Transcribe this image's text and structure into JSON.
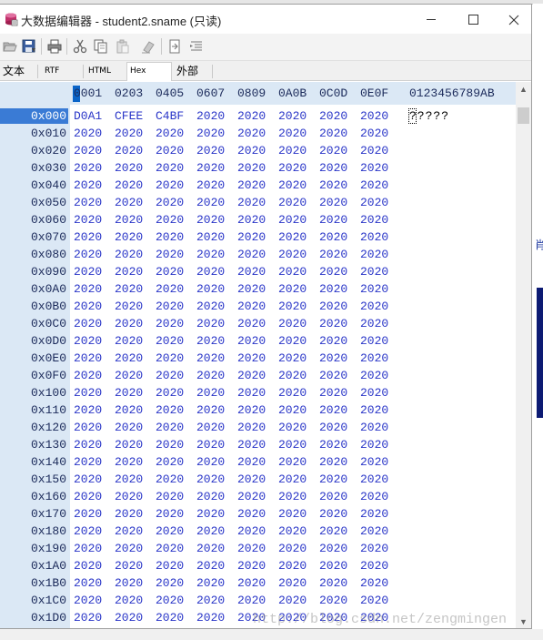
{
  "window": {
    "title": "大数据编辑器 - student2.sname (只读)"
  },
  "toolbar": {
    "buttons": [
      "open-icon",
      "save-icon",
      "print-icon",
      "cut-icon",
      "copy-icon",
      "paste-icon",
      "clear-icon",
      "import-icon",
      "export-icon"
    ]
  },
  "tabs": [
    {
      "label": "文本",
      "active": false
    },
    {
      "label": "RTF",
      "active": false
    },
    {
      "label": "HTML",
      "active": false
    },
    {
      "label": "Hex",
      "active": true
    },
    {
      "label": "外部",
      "active": false
    }
  ],
  "hex": {
    "header_columns": [
      "0001",
      "0203",
      "0405",
      "0607",
      "0809",
      "0A0B",
      "0C0D",
      "0E0F"
    ],
    "header_ascii": "0123456789AB",
    "rows": [
      {
        "addr": "0x000",
        "cells": [
          "D0A1",
          "CFEE",
          "C4BF",
          "2020",
          "2020",
          "2020",
          "2020",
          "2020"
        ],
        "ascii": "?????"
      },
      {
        "addr": "0x010",
        "cells": [
          "2020",
          "2020",
          "2020",
          "2020",
          "2020",
          "2020",
          "2020",
          "2020"
        ],
        "ascii": ""
      },
      {
        "addr": "0x020",
        "cells": [
          "2020",
          "2020",
          "2020",
          "2020",
          "2020",
          "2020",
          "2020",
          "2020"
        ],
        "ascii": ""
      },
      {
        "addr": "0x030",
        "cells": [
          "2020",
          "2020",
          "2020",
          "2020",
          "2020",
          "2020",
          "2020",
          "2020"
        ],
        "ascii": ""
      },
      {
        "addr": "0x040",
        "cells": [
          "2020",
          "2020",
          "2020",
          "2020",
          "2020",
          "2020",
          "2020",
          "2020"
        ],
        "ascii": ""
      },
      {
        "addr": "0x050",
        "cells": [
          "2020",
          "2020",
          "2020",
          "2020",
          "2020",
          "2020",
          "2020",
          "2020"
        ],
        "ascii": ""
      },
      {
        "addr": "0x060",
        "cells": [
          "2020",
          "2020",
          "2020",
          "2020",
          "2020",
          "2020",
          "2020",
          "2020"
        ],
        "ascii": ""
      },
      {
        "addr": "0x070",
        "cells": [
          "2020",
          "2020",
          "2020",
          "2020",
          "2020",
          "2020",
          "2020",
          "2020"
        ],
        "ascii": ""
      },
      {
        "addr": "0x080",
        "cells": [
          "2020",
          "2020",
          "2020",
          "2020",
          "2020",
          "2020",
          "2020",
          "2020"
        ],
        "ascii": ""
      },
      {
        "addr": "0x090",
        "cells": [
          "2020",
          "2020",
          "2020",
          "2020",
          "2020",
          "2020",
          "2020",
          "2020"
        ],
        "ascii": ""
      },
      {
        "addr": "0x0A0",
        "cells": [
          "2020",
          "2020",
          "2020",
          "2020",
          "2020",
          "2020",
          "2020",
          "2020"
        ],
        "ascii": ""
      },
      {
        "addr": "0x0B0",
        "cells": [
          "2020",
          "2020",
          "2020",
          "2020",
          "2020",
          "2020",
          "2020",
          "2020"
        ],
        "ascii": ""
      },
      {
        "addr": "0x0C0",
        "cells": [
          "2020",
          "2020",
          "2020",
          "2020",
          "2020",
          "2020",
          "2020",
          "2020"
        ],
        "ascii": ""
      },
      {
        "addr": "0x0D0",
        "cells": [
          "2020",
          "2020",
          "2020",
          "2020",
          "2020",
          "2020",
          "2020",
          "2020"
        ],
        "ascii": ""
      },
      {
        "addr": "0x0E0",
        "cells": [
          "2020",
          "2020",
          "2020",
          "2020",
          "2020",
          "2020",
          "2020",
          "2020"
        ],
        "ascii": ""
      },
      {
        "addr": "0x0F0",
        "cells": [
          "2020",
          "2020",
          "2020",
          "2020",
          "2020",
          "2020",
          "2020",
          "2020"
        ],
        "ascii": ""
      },
      {
        "addr": "0x100",
        "cells": [
          "2020",
          "2020",
          "2020",
          "2020",
          "2020",
          "2020",
          "2020",
          "2020"
        ],
        "ascii": ""
      },
      {
        "addr": "0x110",
        "cells": [
          "2020",
          "2020",
          "2020",
          "2020",
          "2020",
          "2020",
          "2020",
          "2020"
        ],
        "ascii": ""
      },
      {
        "addr": "0x120",
        "cells": [
          "2020",
          "2020",
          "2020",
          "2020",
          "2020",
          "2020",
          "2020",
          "2020"
        ],
        "ascii": ""
      },
      {
        "addr": "0x130",
        "cells": [
          "2020",
          "2020",
          "2020",
          "2020",
          "2020",
          "2020",
          "2020",
          "2020"
        ],
        "ascii": ""
      },
      {
        "addr": "0x140",
        "cells": [
          "2020",
          "2020",
          "2020",
          "2020",
          "2020",
          "2020",
          "2020",
          "2020"
        ],
        "ascii": ""
      },
      {
        "addr": "0x150",
        "cells": [
          "2020",
          "2020",
          "2020",
          "2020",
          "2020",
          "2020",
          "2020",
          "2020"
        ],
        "ascii": ""
      },
      {
        "addr": "0x160",
        "cells": [
          "2020",
          "2020",
          "2020",
          "2020",
          "2020",
          "2020",
          "2020",
          "2020"
        ],
        "ascii": ""
      },
      {
        "addr": "0x170",
        "cells": [
          "2020",
          "2020",
          "2020",
          "2020",
          "2020",
          "2020",
          "2020",
          "2020"
        ],
        "ascii": ""
      },
      {
        "addr": "0x180",
        "cells": [
          "2020",
          "2020",
          "2020",
          "2020",
          "2020",
          "2020",
          "2020",
          "2020"
        ],
        "ascii": ""
      },
      {
        "addr": "0x190",
        "cells": [
          "2020",
          "2020",
          "2020",
          "2020",
          "2020",
          "2020",
          "2020",
          "2020"
        ],
        "ascii": ""
      },
      {
        "addr": "0x1A0",
        "cells": [
          "2020",
          "2020",
          "2020",
          "2020",
          "2020",
          "2020",
          "2020",
          "2020"
        ],
        "ascii": ""
      },
      {
        "addr": "0x1B0",
        "cells": [
          "2020",
          "2020",
          "2020",
          "2020",
          "2020",
          "2020",
          "2020",
          "2020"
        ],
        "ascii": ""
      },
      {
        "addr": "0x1C0",
        "cells": [
          "2020",
          "2020",
          "2020",
          "2020",
          "2020",
          "2020",
          "2020",
          "2020"
        ],
        "ascii": ""
      },
      {
        "addr": "0x1D0",
        "cells": [
          "2020",
          "2020",
          "2020",
          "2020",
          "2020",
          "2020",
          "2020",
          "2020"
        ],
        "ascii": ""
      }
    ],
    "selected_row": "0x000"
  },
  "background_app": {
    "glyph": "肖"
  },
  "watermark": "http://blog.csdn.net/zengmingen",
  "colors": {
    "gutter": "#dbe8f5",
    "hex_value": "#2a36c8",
    "selection": "#3a7bd5"
  }
}
